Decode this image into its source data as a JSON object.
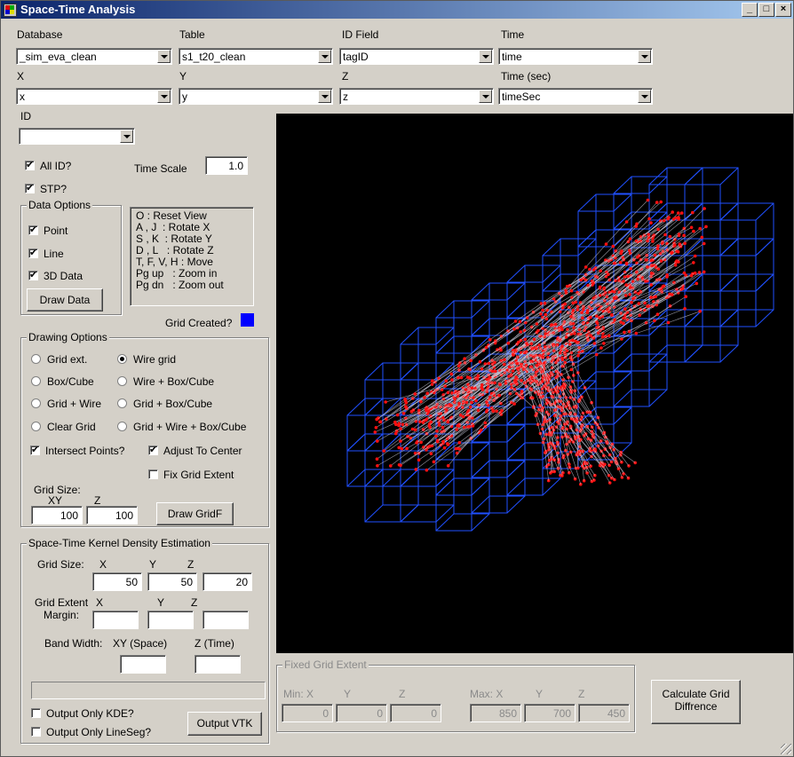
{
  "window": {
    "title": "Space-Time Analysis",
    "min": "_",
    "max": "□",
    "close": "×"
  },
  "fields": {
    "database": {
      "label": "Database",
      "value": "_sim_eva_clean"
    },
    "table": {
      "label": "Table",
      "value": "s1_t20_clean"
    },
    "idfield": {
      "label": "ID Field",
      "value": "tagID"
    },
    "time": {
      "label": "Time",
      "value": "time"
    },
    "x": {
      "label": "X",
      "value": "x"
    },
    "y": {
      "label": "Y",
      "value": "y"
    },
    "z": {
      "label": "Z",
      "value": "z"
    },
    "timesec": {
      "label": "Time (sec)",
      "value": "timeSec"
    }
  },
  "id": {
    "label": "ID",
    "value": ""
  },
  "allid": {
    "label": "All ID?",
    "checked": true
  },
  "stp": {
    "label": "STP?",
    "checked": true
  },
  "timescale": {
    "label": "Time Scale",
    "value": "1.0"
  },
  "data_options": {
    "title": "Data Options",
    "point": "Point",
    "line": "Line",
    "data3d": "3D Data",
    "draw": "Draw Data"
  },
  "keys": [
    "O : Reset View",
    "A , J  : Rotate X",
    "S , K  : Rotate Y",
    "D , L   : Rotate Z",
    "T, F, V, H : Move",
    "Pg up   : Zoom in",
    "Pg dn   : Zoom out"
  ],
  "grid_created": {
    "label": "Grid Created?",
    "color": "#0000ff"
  },
  "drawing_options": {
    "title": "Drawing Options",
    "grid_ext": "Grid ext.",
    "wire_grid": "Wire grid",
    "box_cube": "Box/Cube",
    "wire_box": "Wire + Box/Cube",
    "grid_wire": "Grid + Wire",
    "grid_box": "Grid + Box/Cube",
    "clear_grid": "Clear Grid",
    "grid_wire_box": "Grid + Wire + Box/Cube",
    "intersect": "Intersect Points?",
    "adjust": "Adjust To Center",
    "fix_extent": "Fix Grid Extent",
    "grid_size": "Grid Size:",
    "xy": "XY",
    "z": "Z",
    "xy_value": "100",
    "z_value": "100",
    "draw_grid": "Draw GridF"
  },
  "kde": {
    "title": "Space-Time Kernel Density Estimation",
    "grid_size": "Grid Size:",
    "x": "X",
    "y": "Y",
    "z": "Z",
    "gx": "50",
    "gy": "50",
    "gz": "20",
    "extent": "Grid Extent",
    "margin": "Margin:",
    "band": "Band Width:",
    "xy_space": "XY (Space)",
    "z_time": "Z (Time)",
    "only_kde": "Output Only KDE?",
    "only_lineseg": "Output Only LineSeg?",
    "output_vtk": "Output VTK"
  },
  "fixed_extent": {
    "title": "Fixed Grid Extent",
    "minx": "Min: X",
    "y": "Y",
    "z": "Z",
    "maxx": "Max: X",
    "min_values": [
      "0",
      "0",
      "0"
    ],
    "max_values": [
      "850",
      "700",
      "450"
    ]
  },
  "calc_button": {
    "line1": "Calculate Grid",
    "line2": "Diffrence"
  },
  "colors": {
    "wire": "#2050ff",
    "points": "#ff1010",
    "viewport_bg": "#000000",
    "window_bg": "#d4d0c8"
  }
}
